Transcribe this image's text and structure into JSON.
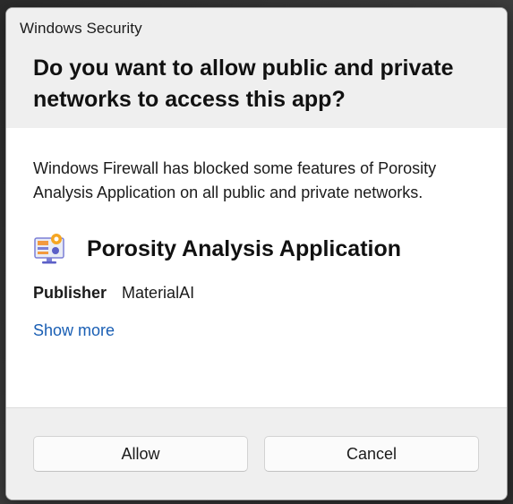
{
  "window": {
    "title": "Windows Security"
  },
  "dialog": {
    "question": "Do you want to allow public and private networks to access this app?",
    "message": "Windows Firewall has blocked some features of Porosity Analysis Application on all public and private networks.",
    "app": {
      "name": "Porosity Analysis Application",
      "icon": "app-monitor-icon"
    },
    "publisher": {
      "label": "Publisher",
      "value": "MaterialAI"
    },
    "show_more_label": "Show more"
  },
  "buttons": {
    "allow_label": "Allow",
    "cancel_label": "Cancel"
  },
  "colors": {
    "link": "#1a5fb4",
    "header_bg": "#efefef",
    "dialog_bg": "#ffffff"
  }
}
